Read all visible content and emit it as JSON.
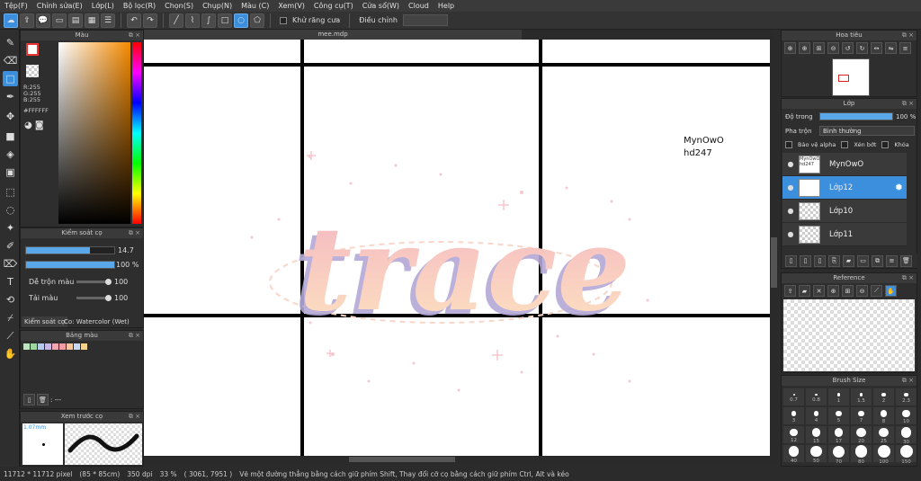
{
  "menu": [
    "Tệp(F)",
    "Chỉnh sửa(E)",
    "Lớp(L)",
    "Bộ lọc(R)",
    "Chọn(S)",
    "Chụp(N)",
    "Màu (C)",
    "Xem(V)",
    "Công cụ(T)",
    "Cửa sổ(W)",
    "Cloud",
    "Help"
  ],
  "toolbar": {
    "antialias_label": "Khử răng cưa",
    "adjust_label": "Điều chỉnh"
  },
  "document": {
    "tab": "mee.mdp"
  },
  "color_panel": {
    "title": "Màu",
    "r": "R:255",
    "g": "G:255",
    "b": "B:255",
    "hex": "#FFFFFF"
  },
  "brush_control": {
    "title": "Kiểm soát cọ",
    "size_value": "14.7",
    "opacity_value": "100 %",
    "blend_label": "Dễ trộn màu",
    "blend_value": "100",
    "wet_label": "Tải màu",
    "wet_value": "100",
    "size_fill": 0.72,
    "opacity_fill": 1.0,
    "tab_label": "Kiểm soát cọ",
    "brush_name": "Co: Watercolor (Wet)"
  },
  "palette": {
    "title": "Bảng màu",
    "footer": ": ---",
    "colors": [
      "#bfe3c0",
      "#9fd6a0",
      "#b8c8ea",
      "#c5b6e6",
      "#f4a6b0",
      "#f29aa5",
      "#f8c7a0",
      "#c8d8f0",
      "#f6d38a"
    ]
  },
  "preview": {
    "title": "Xem trước cọ",
    "size": "1.07mm"
  },
  "canvas": {
    "text1": "MynOwO",
    "text2": "hd247",
    "art_word": "trace"
  },
  "navigator": {
    "title": "Hoa tiêu"
  },
  "layers": {
    "title": "Lớp",
    "opacity_label": "Độ trong",
    "opacity_value": "100 %",
    "blend_label": "Pha trộn",
    "blend_value": "Bình thường",
    "protect_alpha": "Bảo vệ alpha",
    "clip": "Xén bớt",
    "lock": "Khóa",
    "items": [
      {
        "name": "MynOwO",
        "thumb": "MynOwO hd247"
      },
      {
        "name": "Lớp12",
        "thumb": ""
      },
      {
        "name": "Lớp10",
        "thumb": ""
      },
      {
        "name": "Lớp11",
        "thumb": ""
      }
    ]
  },
  "reference": {
    "title": "Reference"
  },
  "brush_size": {
    "title": "Brush Size",
    "labels": [
      "0.7",
      "0.8",
      "1",
      "1.5",
      "2",
      "2.3",
      "3",
      "4",
      "5",
      "7",
      "8",
      "10",
      "12",
      "15",
      "17",
      "20",
      "25",
      "30",
      "40",
      "50",
      "70",
      "80",
      "100",
      "150"
    ]
  },
  "status": {
    "size": "11712 * 11712 pixel",
    "cm": "(85 * 85cm)",
    "dpi": "350 dpi",
    "zoom": "33 %",
    "coords": "( 3061, 7951 )",
    "hint": "Vẽ một đường thẳng bằng cách giữ phím Shift, Thay đổi cỡ cọ bằng cách giữ phím Ctrl, Alt và kéo"
  },
  "colors": {
    "accent": "#3b8fdc",
    "art_pink": "#f4b6c2",
    "art_peach": "#fde2c0",
    "art_shadow": "#b3a8d6"
  }
}
